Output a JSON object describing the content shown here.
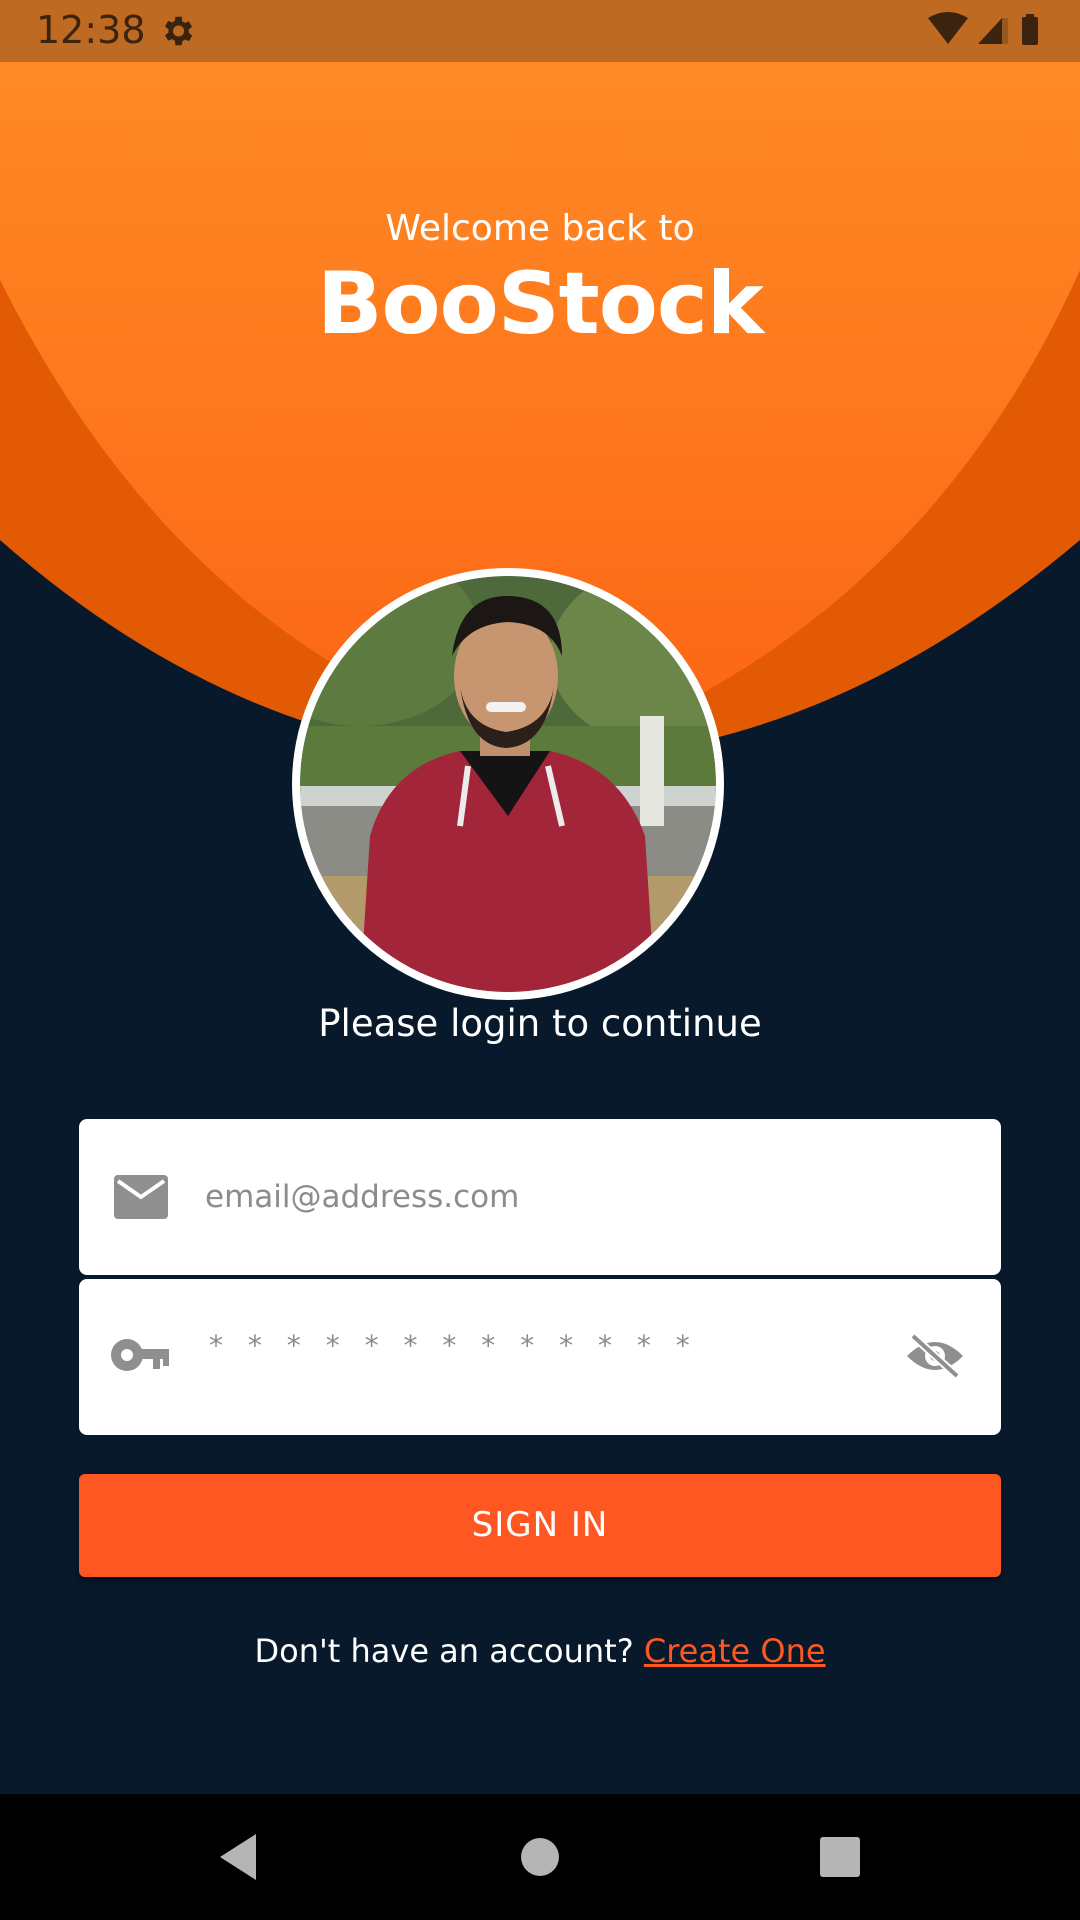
{
  "status_bar": {
    "time": "12:38",
    "icons": [
      "gear-icon",
      "wifi-icon",
      "cell-signal-icon",
      "battery-icon"
    ],
    "color": "#bf6a22"
  },
  "header": {
    "welcome": "Welcome back to",
    "brand": "BooStock"
  },
  "login": {
    "prompt": "Please login to continue",
    "email": {
      "placeholder": "email@address.com",
      "icon": "mail-icon"
    },
    "password": {
      "placeholder": "* * * * * * * * * * * * *",
      "icon": "key-icon",
      "toggle_icon": "eye-off-icon"
    },
    "sign_in_label": "SIGN IN",
    "signup_text": "Don't have an account?",
    "signup_link": "Create One"
  },
  "nav": {
    "icons": [
      "back-icon",
      "home-icon",
      "recent-apps-icon"
    ]
  },
  "colors": {
    "background": "#07192b",
    "accent": "#fe5722",
    "header_orange": "#ff8a24",
    "header_dark_orange": "#e35a05"
  }
}
